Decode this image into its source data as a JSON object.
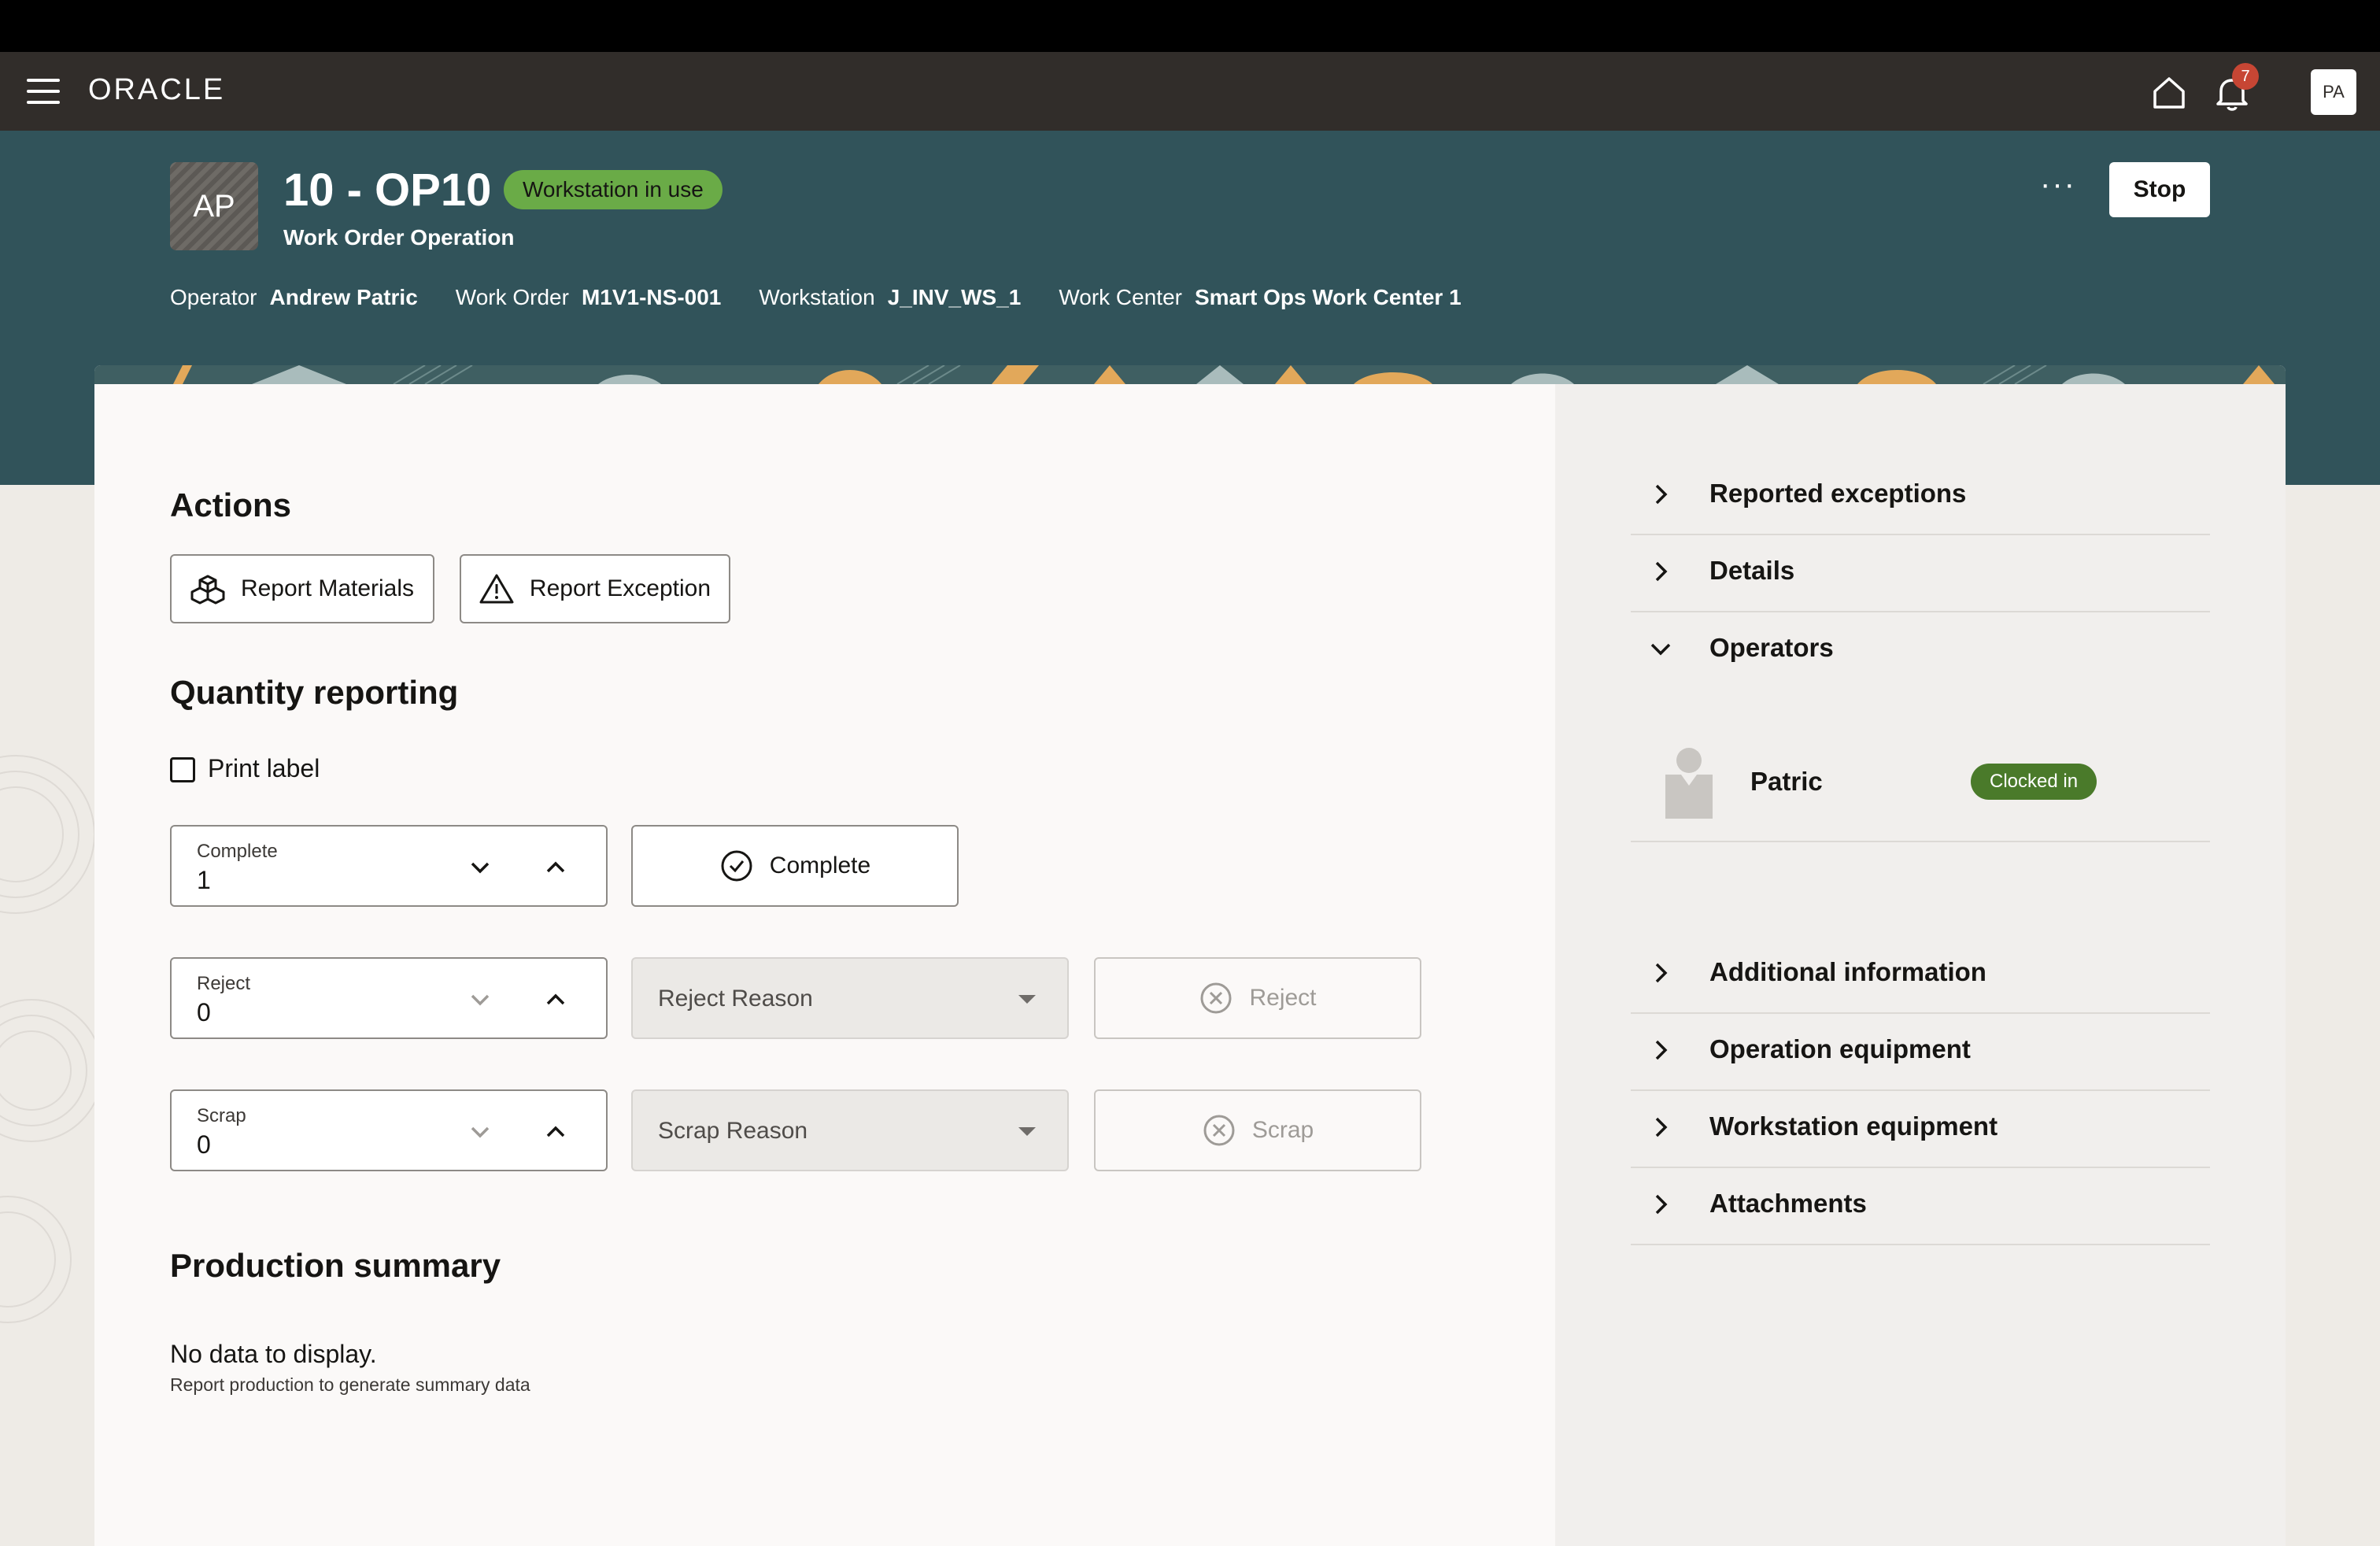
{
  "navbar": {
    "brand": "ORACLE",
    "notification_count": "7",
    "user_initials": "PA"
  },
  "header": {
    "avatar_initials": "AP",
    "title": "10 - OP10",
    "status_badge": "Workstation in use",
    "subtitle": "Work Order Operation",
    "meta": [
      {
        "label": "Operator",
        "value": "Andrew Patric"
      },
      {
        "label": "Work Order",
        "value": "M1V1-NS-001"
      },
      {
        "label": "Workstation",
        "value": "J_INV_WS_1"
      },
      {
        "label": "Work Center",
        "value": "Smart Ops Work Center 1"
      }
    ],
    "more_label": "···",
    "stop_label": "Stop"
  },
  "actions": {
    "title": "Actions",
    "report_materials": "Report Materials",
    "report_exception": "Report Exception"
  },
  "quantity": {
    "title": "Quantity reporting",
    "print_label": "Print label",
    "complete": {
      "label": "Complete",
      "value": "1",
      "button": "Complete"
    },
    "reject": {
      "label": "Reject",
      "value": "0",
      "reason_placeholder": "Reject Reason",
      "button": "Reject"
    },
    "scrap": {
      "label": "Scrap",
      "value": "0",
      "reason_placeholder": "Scrap Reason",
      "button": "Scrap"
    }
  },
  "summary": {
    "title": "Production summary",
    "empty": "No data to display.",
    "empty_sub": "Report production to generate summary data"
  },
  "panel": {
    "items_top": [
      "Reported exceptions",
      "Details",
      "Operators"
    ],
    "operator": {
      "name": "Patric",
      "status": "Clocked in"
    },
    "items_bottom": [
      "Additional information",
      "Operation equipment",
      "Workstation equipment",
      "Attachments"
    ]
  },
  "colors": {
    "navbar": "#312d2a",
    "header": "#31535a",
    "workstation_badge": "#6aab47",
    "clocked_badge": "#4a7a2a",
    "notification_badge": "#c74634"
  }
}
